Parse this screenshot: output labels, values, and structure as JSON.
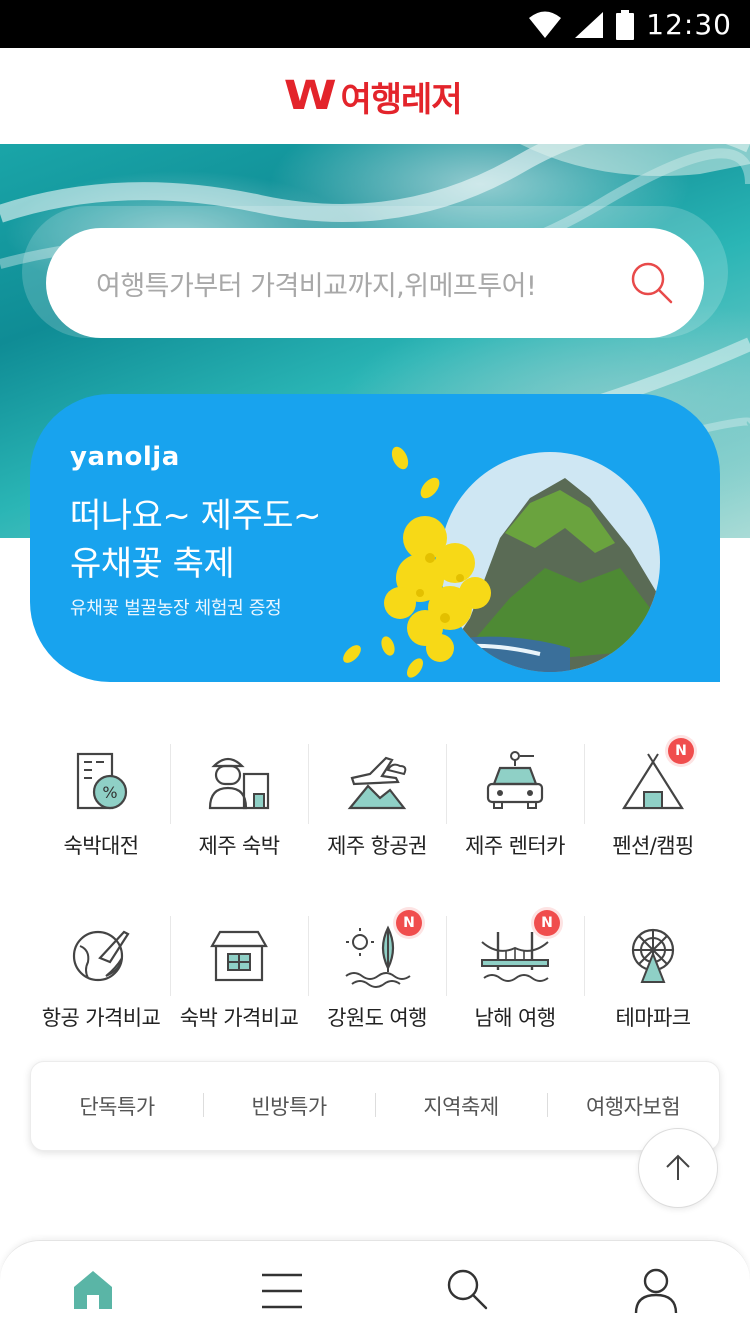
{
  "status_bar": {
    "time": "12:30"
  },
  "header": {
    "brand_mark": "W",
    "title": "여행레저"
  },
  "search": {
    "placeholder": "여행특가부터 가격비교까지,위메프투어!"
  },
  "banner": {
    "brand": "yanolja",
    "title_line1": "떠나요~ 제주도~",
    "title_line2": "유채꽃 축제",
    "subtitle": "유채꽃 벌꿀농장 체험권 증정",
    "colors": {
      "background": "#18a3ee",
      "flower": "#f7d917"
    }
  },
  "categories": {
    "row1": [
      {
        "label": "숙박대전",
        "icon": "discount-hotel-icon",
        "badge": ""
      },
      {
        "label": "제주 숙박",
        "icon": "jeju-stay-icon",
        "badge": ""
      },
      {
        "label": "제주 항공권",
        "icon": "airplane-icon",
        "badge": ""
      },
      {
        "label": "제주 렌터카",
        "icon": "taxi-car-icon",
        "badge": ""
      },
      {
        "label": "펜션/캠핑",
        "icon": "camping-tent-icon",
        "badge": "N"
      }
    ],
    "row2": [
      {
        "label": "항공 가격비교",
        "icon": "globe-plane-icon",
        "badge": ""
      },
      {
        "label": "숙박 가격비교",
        "icon": "house-icon",
        "badge": ""
      },
      {
        "label": "강원도 여행",
        "icon": "sun-sailboat-icon",
        "badge": "N"
      },
      {
        "label": "남해 여행",
        "icon": "bridge-icon",
        "badge": "N"
      },
      {
        "label": "테마파크",
        "icon": "ferris-wheel-icon",
        "badge": ""
      }
    ]
  },
  "quick_tabs": [
    "단독특가",
    "빈방특가",
    "지역축제",
    "여행자보험"
  ],
  "bottom_nav": [
    {
      "name": "home",
      "icon": "home-icon",
      "active": true
    },
    {
      "name": "menu",
      "icon": "menu-icon",
      "active": false
    },
    {
      "name": "search",
      "icon": "search-icon",
      "active": false
    },
    {
      "name": "my",
      "icon": "user-icon",
      "active": false
    }
  ],
  "colors": {
    "brand": "#e3242b",
    "accent_teal": "#5ab5a6",
    "badge": "#f04d4d"
  }
}
